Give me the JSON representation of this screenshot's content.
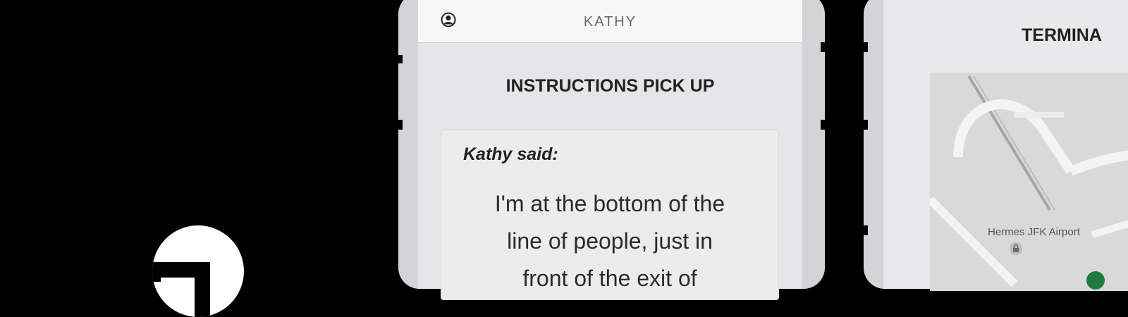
{
  "phone1": {
    "header": {
      "name": "KATHY"
    },
    "section_title": "INSTRUCTIONS PICK UP",
    "message": {
      "author_label": "Kathy said:",
      "lines": [
        "I'm at the bottom of the",
        "line of people, just in",
        "front of the exit of"
      ]
    }
  },
  "phone2": {
    "title": "TERMINA",
    "map": {
      "label": "Hermes JFK Airport"
    }
  },
  "colors": {
    "background": "#000000",
    "phone_frame": "#d4d4d6",
    "marker": "#1f7a3f"
  },
  "icons": {
    "header_left": "user-circle-icon",
    "map_poi": "lock-icon",
    "map_marker": "location-dot-icon"
  }
}
